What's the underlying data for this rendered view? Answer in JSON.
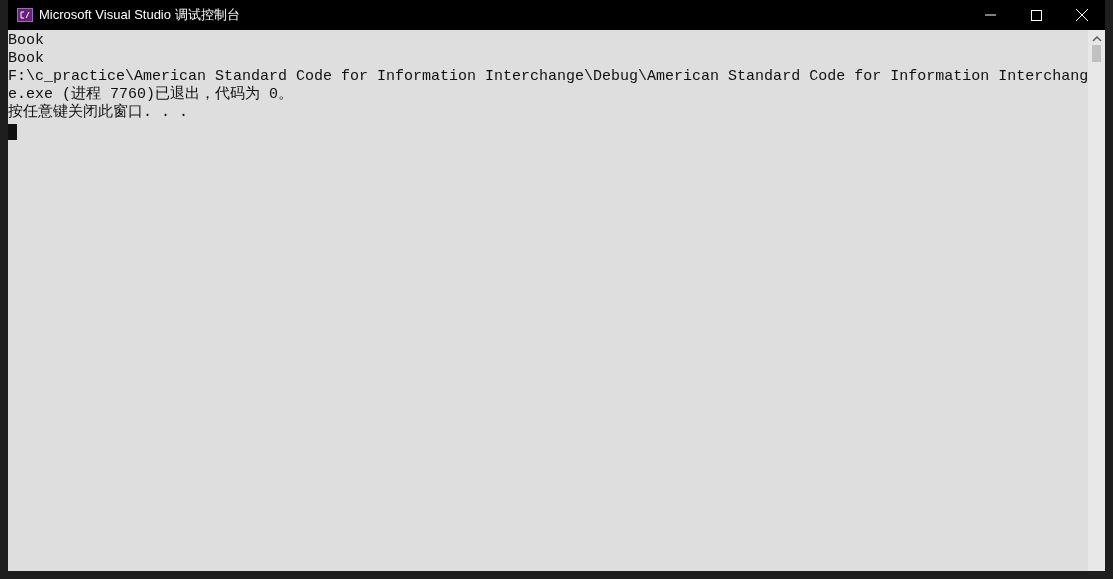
{
  "console": {
    "title": "Microsoft Visual Studio 调试控制台",
    "lines": [
      "Book",
      "Book",
      "F:\\c_practice\\American Standard Code for Information Interchange\\Debug\\American Standard Code for Information Interchang",
      "e.exe (进程 7760)已退出，代码为 0。",
      "按任意键关闭此窗口. . ."
    ]
  }
}
